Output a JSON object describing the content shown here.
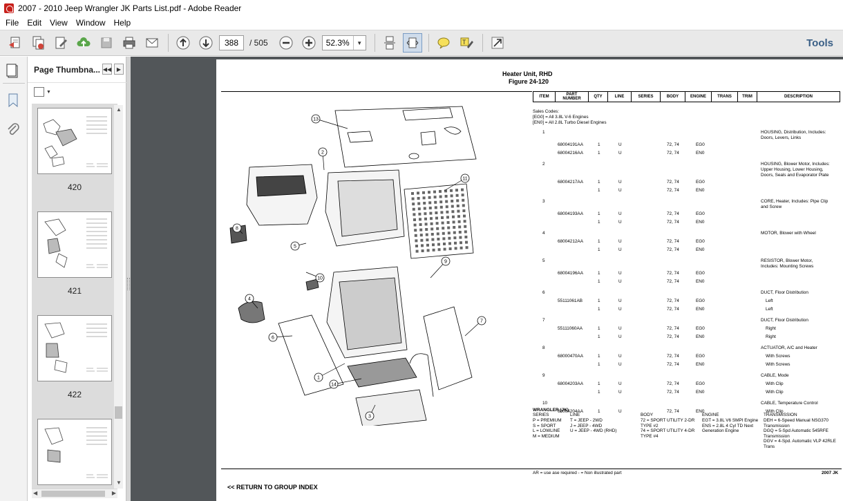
{
  "window": {
    "title": "2007 - 2010 Jeep Wrangler JK Parts List.pdf - Adobe Reader"
  },
  "menu": [
    "File",
    "Edit",
    "View",
    "Window",
    "Help"
  ],
  "toolbar": {
    "page_current": "388",
    "page_of": "/  505",
    "zoom": "52.3%",
    "tools_label": "Tools"
  },
  "thumbs": {
    "header": "Page Thumbna...",
    "pages": [
      "420",
      "421",
      "422"
    ]
  },
  "doc": {
    "title": "Heater Unit, RHD",
    "figure": "Figure 24-120",
    "columns": [
      "ITEM",
      "PART\nNUMBER",
      "QTY",
      "LINE",
      "SERIES",
      "BODY",
      "ENGINE",
      "TRANS",
      "TRIM",
      "DESCRIPTION"
    ],
    "sales_codes": [
      "Sales Codes:",
      "[EG0] = All 3.8L V-6 Engines",
      "[EN0] = All 2.8L Turbo Diesel Engines"
    ],
    "rows": [
      {
        "item": "1",
        "desc": [
          "HOUSING, Distribution, Includes:",
          "Doors, Levers, Links"
        ],
        "parts": [
          {
            "pn": "68004191AA",
            "qty": "1",
            "line": "U",
            "body": "72, 74",
            "eng": "EG0"
          },
          {
            "pn": "68004216AA",
            "qty": "1",
            "line": "U",
            "body": "72, 74",
            "eng": "EN0"
          }
        ]
      },
      {
        "item": "2",
        "desc": [
          "HOUSING, Blower Motor, Includes:",
          "Upper Housing, Lower Housing,",
          "Doors, Seals and Evaporator Plate"
        ],
        "parts": [
          {
            "pn": "68004217AA",
            "qty": "1",
            "line": "U",
            "body": "72, 74",
            "eng": "EG0"
          },
          {
            "pn": "",
            "qty": "1",
            "line": "U",
            "body": "72, 74",
            "eng": "EN0"
          }
        ]
      },
      {
        "item": "3",
        "desc": [
          "CORE, Heater, Includes: Pipe Clip",
          "and Screw"
        ],
        "parts": [
          {
            "pn": "68004193AA",
            "qty": "1",
            "line": "U",
            "body": "72, 74",
            "eng": "EG0"
          },
          {
            "pn": "",
            "qty": "1",
            "line": "U",
            "body": "72, 74",
            "eng": "EN0"
          }
        ]
      },
      {
        "item": "4",
        "desc": [
          "MOTOR, Blower with Wheel"
        ],
        "parts": [
          {
            "pn": "68004212AA",
            "qty": "1",
            "line": "U",
            "body": "72, 74",
            "eng": "EG0"
          },
          {
            "pn": "",
            "qty": "1",
            "line": "U",
            "body": "72, 74",
            "eng": "EN0"
          }
        ]
      },
      {
        "item": "5",
        "desc": [
          "RESISTOR, Blower Motor,",
          "Includes: Mounting Screws"
        ],
        "parts": [
          {
            "pn": "68004196AA",
            "qty": "1",
            "line": "U",
            "body": "72, 74",
            "eng": "EG0"
          },
          {
            "pn": "",
            "qty": "1",
            "line": "U",
            "body": "72, 74",
            "eng": "EN0"
          }
        ]
      },
      {
        "item": "6",
        "desc": [
          "DUCT, Floor Distribution"
        ],
        "parts": [
          {
            "pn": "55111061AB",
            "qty": "1",
            "line": "U",
            "body": "72, 74",
            "eng": "EG0",
            "d": "Left"
          },
          {
            "pn": "",
            "qty": "1",
            "line": "U",
            "body": "72, 74",
            "eng": "EN0",
            "d": "Left"
          }
        ]
      },
      {
        "item": "7",
        "desc": [
          "DUCT, Floor Distribution"
        ],
        "parts": [
          {
            "pn": "55111060AA",
            "qty": "1",
            "line": "U",
            "body": "72, 74",
            "eng": "EG0",
            "d": "Right"
          },
          {
            "pn": "",
            "qty": "1",
            "line": "U",
            "body": "72, 74",
            "eng": "EN0",
            "d": "Right"
          }
        ]
      },
      {
        "item": "8",
        "desc": [
          "ACTUATOR, A/C and Heater"
        ],
        "parts": [
          {
            "pn": "68000470AA",
            "qty": "1",
            "line": "U",
            "body": "72, 74",
            "eng": "EG0",
            "d": "With Screws"
          },
          {
            "pn": "",
            "qty": "1",
            "line": "U",
            "body": "72, 74",
            "eng": "EN0",
            "d": "With Screws"
          }
        ]
      },
      {
        "item": "9",
        "desc": [
          "CABLE, Mode"
        ],
        "parts": [
          {
            "pn": "68004203AA",
            "qty": "1",
            "line": "U",
            "body": "72, 74",
            "eng": "EG0",
            "d": "With Clip"
          },
          {
            "pn": "",
            "qty": "1",
            "line": "U",
            "body": "72, 74",
            "eng": "EN0",
            "d": "With Clip"
          }
        ]
      },
      {
        "item": "10",
        "desc": [
          "CABLE, Temperature Control"
        ],
        "parts": [
          {
            "pn": "68004204AA",
            "qty": "1",
            "line": "U",
            "body": "72, 74",
            "eng": "EN0",
            "d": "With Clip"
          }
        ]
      }
    ],
    "legend": {
      "heading": "WRANGLER (JK)",
      "series_h": "SERIES",
      "series": [
        "P = PREMIUM",
        "S = SPORT",
        "L = LOWLINE",
        "M = MEDIUM"
      ],
      "line_h": "LINE",
      "line": [
        "T = JEEP - 2WD",
        "J = JEEP - 4WD",
        "U = JEEP - 4WD (RHD)"
      ],
      "body_h": "BODY",
      "body": [
        "72 = SPORT UTILITY 2-DR",
        "TYPE #2",
        "74 = SPORT UTILITY 4-DR",
        "TYPE #4"
      ],
      "engine_h": "ENGINE",
      "engine": [
        "EGT = 3.8L V6 SMPI Engine",
        "ENS = 2.8L 4 Cyl TD Next",
        "Generation Engine"
      ],
      "trans_h": "TRANSMISSION",
      "trans": [
        "DEH = 6-Speed Manual NSG370",
        "Transmission",
        "DGQ = 5-Spd Automatic 545RFE",
        "Transmission",
        "DGV = 4-Spd. Automatic VLP 42RLE",
        "Trans"
      ]
    },
    "footer_note": "AR = use ase required    - = Non illustrated part",
    "footer_right": "2007  JK",
    "return_link": "<< RETURN TO GROUP INDEX",
    "callouts": [
      "13",
      "2",
      "11",
      "8",
      "5",
      "4",
      "10",
      "9",
      "6",
      "1",
      "14",
      "7",
      "3"
    ]
  },
  "colors": {
    "accent": "#3a5f86",
    "doc_bg": "#525659",
    "toolbar_bg": "#e9e9e9"
  }
}
